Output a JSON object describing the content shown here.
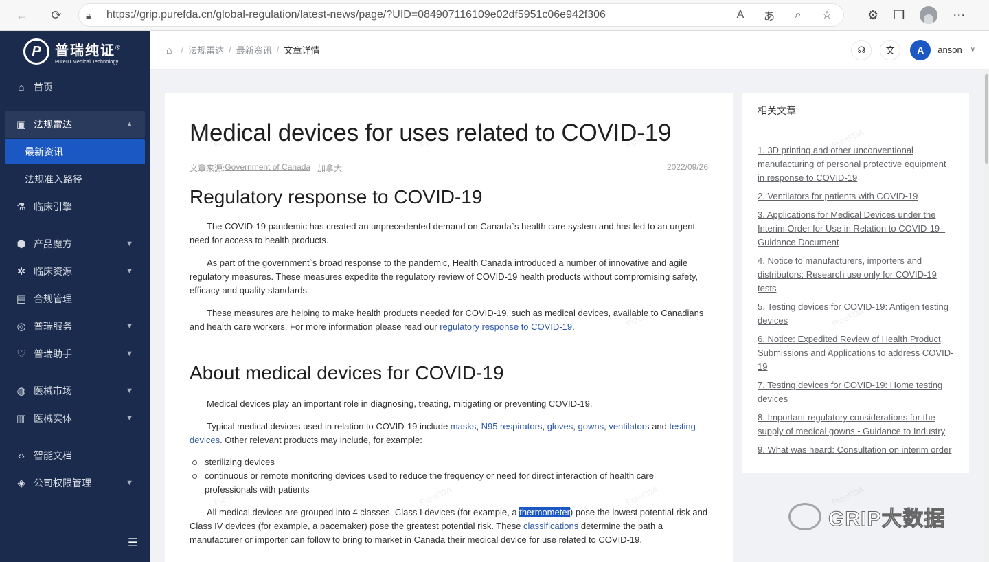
{
  "browser": {
    "url": "https://grip.purefda.cn/global-regulation/latest-news/page/?UID=084907116109e02df5951c06e942f306"
  },
  "brand": {
    "name_cn": "普瑞纯证",
    "name_en": "PureID Medical Technology"
  },
  "sidebar": {
    "items": [
      {
        "label": "首页"
      },
      {
        "label": "法规雷达"
      },
      {
        "label": "最新资讯"
      },
      {
        "label": "法规准入路径"
      },
      {
        "label": "临床引擎"
      },
      {
        "label": "产品魔方"
      },
      {
        "label": "临床资源"
      },
      {
        "label": "合规管理"
      },
      {
        "label": "普瑞服务"
      },
      {
        "label": "普瑞助手"
      },
      {
        "label": "医械市场"
      },
      {
        "label": "医械实体"
      },
      {
        "label": "智能文档"
      },
      {
        "label": "公司权限管理"
      }
    ]
  },
  "breadcrumb": [
    "法规雷达",
    "最新资讯",
    "文章详情"
  ],
  "user": {
    "initial": "A",
    "name": "anson"
  },
  "article": {
    "title": "Medical devices for uses related to COVID-19",
    "source_label": "文章来源:",
    "source_name": "Government of Canada",
    "country": "加拿大",
    "date": "2022/09/26",
    "h1": "Regulatory response to COVID-19",
    "p1": "The COVID-19 pandemic has created an unprecedented demand on Canada`s health care system and has led to an urgent need for access to health products.",
    "p2": "As part of the government`s broad response to the pandemic, Health Canada introduced a number of innovative and agile regulatory measures. These measures expedite the regulatory review of COVID-19 health products without compromising safety, efficacy and quality standards.",
    "p3_text": "These measures are helping to make health products needed for COVID-19, such as medical devices, available to Canadians and health care workers. For more information please read our ",
    "p3_link": "regulatory response to COVID-19",
    "h2": "About medical devices for COVID-19",
    "p4": "Medical devices play an important role in diagnosing, treating, mitigating or preventing COVID-19.",
    "p5_a": "Typical medical devices used in relation to COVID-19 include ",
    "p5_masks": "masks",
    "p5_n95": "N95 respirators",
    "p5_gloves": "gloves",
    "p5_gowns": "gowns",
    "p5_vent": "ventilators",
    "p5_and": " and ",
    "p5_testing": "testing devices",
    "p5_b": ". Other relevant products may include, for example:",
    "bullets": [
      "sterilizing devices",
      "continuous or remote monitoring devices used to reduce the frequency or need for direct interaction of health care professionals with patients"
    ],
    "p6_a": "All medical devices are grouped into 4 classes. Class I devices (for example, a ",
    "p6_hl": "thermometer",
    "p6_b": ") pose the lowest potential risk and Class IV devices (for example, a pacemaker) pose the greatest potential risk. These ",
    "p6_link": "classifications",
    "p6_c": " determine the path a manufacturer or importer can follow to bring to market in Canada their medical device for use related to COVID-19."
  },
  "related": {
    "title": "相关文章",
    "items": [
      "1. 3D printing and other unconventional manufacturing of personal protective equipment in response to COVID-19",
      "2. Ventilators for patients with COVID-19",
      "3. Applications for Medical Devices under the Interim Order for Use in Relation to COVID-19 - Guidance Document",
      "4. Notice to manufacturers, importers and distributors: Research use only for COVID-19 tests",
      "5. Testing devices for COVID-19: Antigen testing devices",
      "6. Notice: Expedited Review of Health Product Submissions and Applications to address COVID-19",
      "7. Testing devices for COVID-19: Home testing devices",
      "8. Important regulatory considerations for the supply of medical gowns - Guidance to Industry",
      "9. What was heard: Consultation on interim order"
    ]
  },
  "watermark": {
    "text": "PureFDA",
    "brand": "GRIP大数据"
  },
  "colors": {
    "sidebar_bg": "#1b2b4e",
    "active_blue": "#1c58c4",
    "link": "#2c57a8"
  }
}
